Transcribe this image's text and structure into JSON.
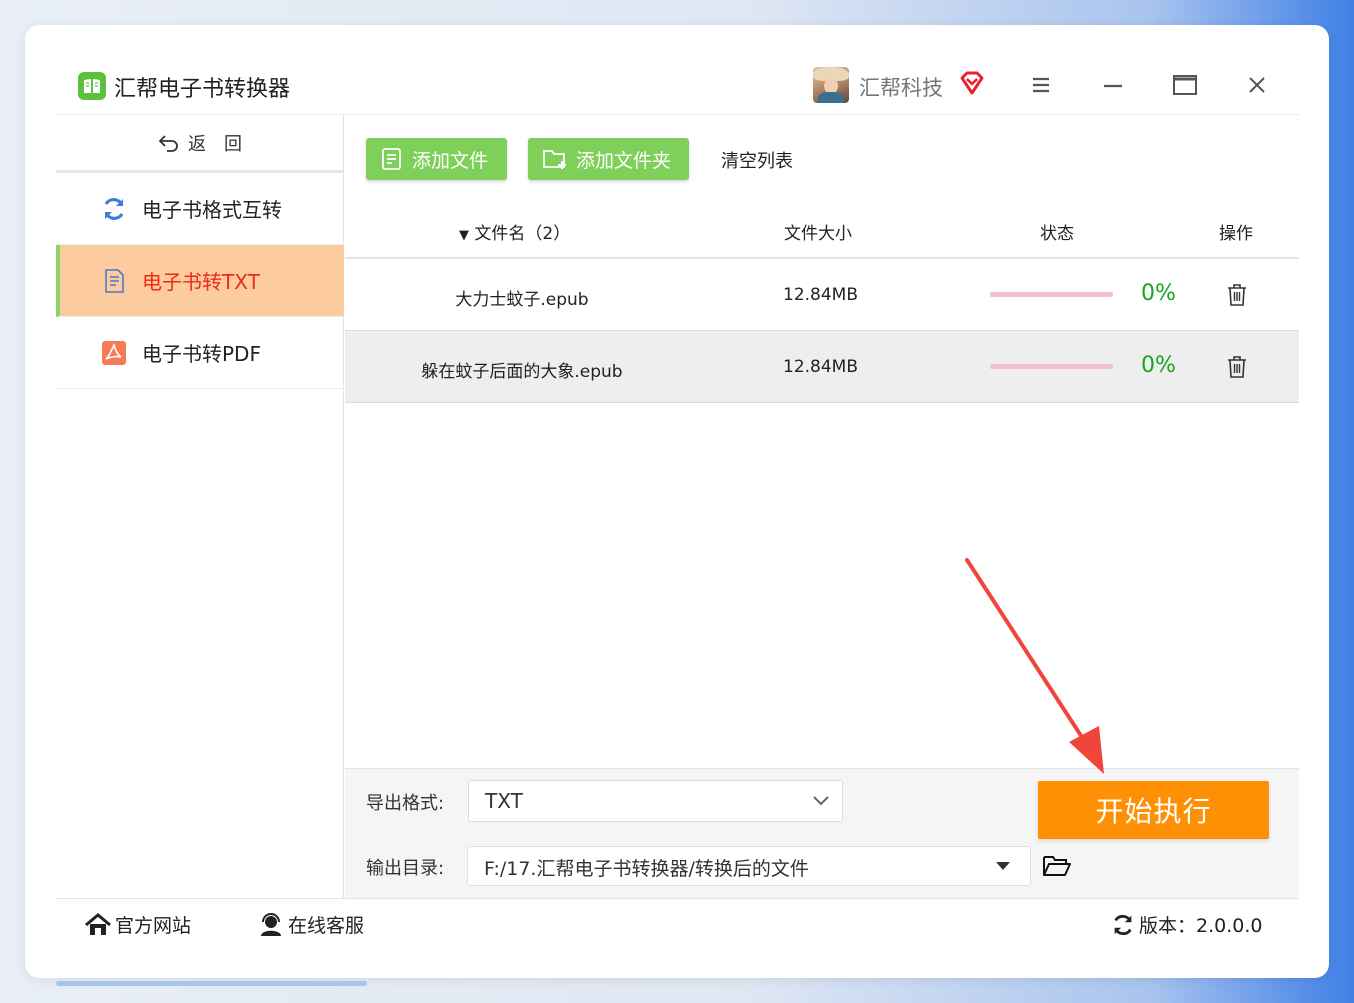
{
  "app": {
    "title": "汇帮电子书转换器",
    "company": "汇帮科技"
  },
  "sidebar": {
    "back_label": "返　回",
    "items": [
      {
        "label": "电子书格式互转",
        "icon": "refresh-icon"
      },
      {
        "label": "电子书转TXT",
        "icon": "txt-document-icon",
        "active": true
      },
      {
        "label": "电子书转PDF",
        "icon": "pdf-icon"
      }
    ]
  },
  "toolbar": {
    "add_file": "添加文件",
    "add_folder": "添加文件夹",
    "clear_list": "清空列表"
  },
  "table": {
    "headers": {
      "name": "文件名（2）",
      "size": "文件大小",
      "status": "状态",
      "operation": "操作"
    },
    "rows": [
      {
        "name": "大力士蚊子.epub",
        "size": "12.84MB",
        "progress": "0%",
        "progress_value": 0
      },
      {
        "name": "躲在蚊子后面的大象.epub",
        "size": "12.84MB",
        "progress": "0%",
        "progress_value": 0
      }
    ]
  },
  "settings": {
    "format_label": "导出格式:",
    "format_value": "TXT",
    "dir_label": "输出目录:",
    "dir_value": "F:/17.汇帮电子书转换器/转换后的文件",
    "start_button": "开始执行"
  },
  "footer": {
    "website": "官方网站",
    "service": "在线客服",
    "version": "版本：2.0.0.0"
  },
  "colors": {
    "accent_green": "#7ed05a",
    "active_nav_bg": "#fccb9e",
    "active_nav_text": "#ee2b16",
    "start_orange": "#fd9005",
    "percent_green": "#19a51e",
    "arrow_red": "#f0453a"
  }
}
